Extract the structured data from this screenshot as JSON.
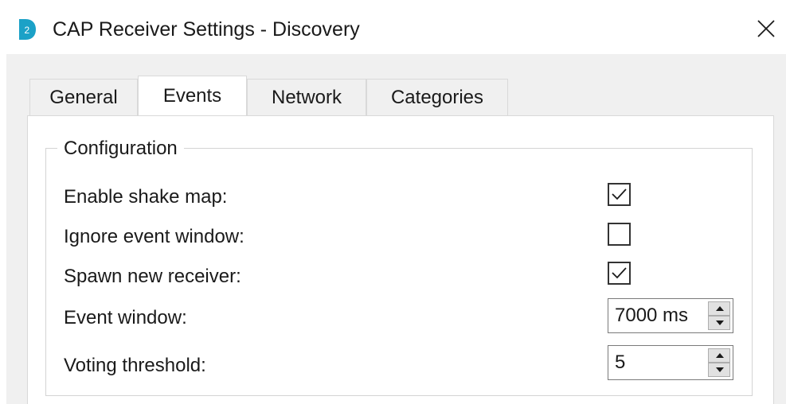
{
  "window": {
    "title": "CAP Receiver Settings - Discovery",
    "app_icon": "d2-logo-icon",
    "close_icon": "close-icon",
    "accent_color": "#1ba1c7"
  },
  "tabs": [
    {
      "label": "General",
      "active": false
    },
    {
      "label": "Events",
      "active": true
    },
    {
      "label": "Network",
      "active": false
    },
    {
      "label": "Categories",
      "active": false
    }
  ],
  "configuration": {
    "group_label": "Configuration",
    "enable_shake_map": {
      "label": "Enable shake map:",
      "checked": true
    },
    "ignore_event_window": {
      "label": "Ignore event window:",
      "checked": false
    },
    "spawn_new_receiver": {
      "label": "Spawn new receiver:",
      "checked": true
    },
    "event_window": {
      "label": "Event window:",
      "value": "7000 ms"
    },
    "voting_threshold": {
      "label": "Voting threshold:",
      "value": "5"
    }
  }
}
